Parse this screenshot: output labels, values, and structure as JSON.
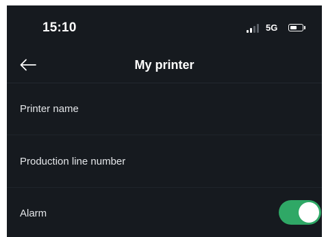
{
  "status_bar": {
    "time": "15:10",
    "network": "5G",
    "signal_bars_active": 2,
    "signal_bars_total": 4,
    "battery_level": 0.6
  },
  "nav": {
    "title": "My printer",
    "back_icon": "arrow-left-icon"
  },
  "rows": [
    {
      "label": "Printer name"
    },
    {
      "label": "Production line number"
    },
    {
      "label": "Alarm"
    }
  ],
  "alarm_toggle": {
    "on": true
  },
  "colors": {
    "background": "#161a1f",
    "toggle_on": "#2fa866",
    "text": "#e4e6e9",
    "signal_dim": "#5a5f66"
  }
}
